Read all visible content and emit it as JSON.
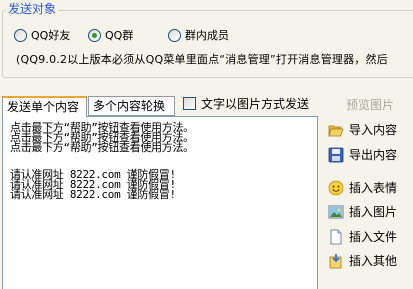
{
  "group": {
    "legend": "发送对象",
    "radios": [
      {
        "label": "QQ好友",
        "selected": false
      },
      {
        "label": "QQ群",
        "selected": true
      },
      {
        "label": "群内成员",
        "selected": false
      }
    ],
    "hint": "(QQ9.0.2以上版本必须从QQ菜单里面点“消息管理”打开消息管理器，然后"
  },
  "tabs": [
    {
      "label": "发送单个内容",
      "active": true
    },
    {
      "label": "多个内容轮换",
      "active": false
    }
  ],
  "image_mode": {
    "label": "文字以图片方式发送",
    "checked": false
  },
  "preview_label": "预览图片",
  "content": {
    "lines_a": [
      "点击最下方“帮助”按钮查看使用方法。",
      "点击最下方“帮助”按钮查看使用方法。",
      "点击最下方“帮助”按钮查看使用方法。"
    ],
    "lines_b": [
      "请认准网址 8222.com 谨防假冒!",
      "请认准网址 8222.com 谨防假冒!",
      "请认准网址 8222.com 谨防假冒!"
    ]
  },
  "side_buttons": [
    {
      "label": "导入内容",
      "icon": "folder-open-icon"
    },
    {
      "label": "导出内容",
      "icon": "floppy-disk-icon"
    },
    {
      "label": "插入表情",
      "icon": "smiley-icon"
    },
    {
      "label": "插入图片",
      "icon": "picture-icon"
    },
    {
      "label": "插入文件",
      "icon": "document-icon"
    },
    {
      "label": "插入其他",
      "icon": "insert-other-icon"
    }
  ],
  "colors": {
    "accent": "#2a5ad8",
    "background": "#f6f3ea",
    "tab_highlight": "#f4a52d"
  }
}
